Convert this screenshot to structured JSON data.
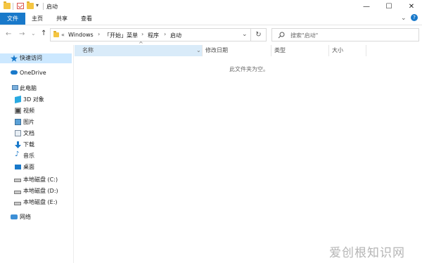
{
  "window": {
    "title": "启动",
    "minimize_glyph": "—",
    "maximize_glyph": "☐",
    "close_glyph": "✕",
    "help_glyph": "?",
    "expand_glyph": "⌄"
  },
  "quick_access_toolbar": {
    "dropdown_glyph": "▾"
  },
  "ribbon": {
    "tabs": [
      {
        "label": "文件"
      },
      {
        "label": "主页"
      },
      {
        "label": "共享"
      },
      {
        "label": "查看"
      }
    ]
  },
  "navigation": {
    "back_glyph": "←",
    "forward_glyph": "→",
    "recent_glyph": "⌄",
    "up_glyph": "↑",
    "refresh_glyph": "↻"
  },
  "address_bar": {
    "overflow": "«",
    "crumbs": [
      "Windows",
      "「开始」菜单",
      "程序",
      "启动"
    ],
    "separator": "›",
    "dropdown_glyph": "⌄"
  },
  "search": {
    "placeholder": "搜索\"启动\"",
    "icon": "search-icon"
  },
  "sidebar": {
    "quick_access": "快速访问",
    "onedrive": "OneDrive",
    "this_pc": "此电脑",
    "items": [
      {
        "label": "3D 对象",
        "icon": "cube-icon"
      },
      {
        "label": "视频",
        "icon": "video-icon"
      },
      {
        "label": "图片",
        "icon": "picture-icon"
      },
      {
        "label": "文档",
        "icon": "document-icon"
      },
      {
        "label": "下载",
        "icon": "download-icon"
      },
      {
        "label": "音乐",
        "icon": "music-icon"
      },
      {
        "label": "桌面",
        "icon": "desktop-icon"
      },
      {
        "label": "本地磁盘 (C:)",
        "icon": "drive-icon"
      },
      {
        "label": "本地磁盘 (D:)",
        "icon": "drive-icon"
      },
      {
        "label": "本地磁盘 (E:)",
        "icon": "drive-icon"
      }
    ],
    "network": "网络"
  },
  "columns": {
    "name": "名称",
    "modified": "修改日期",
    "type": "类型",
    "size": "大小",
    "sort_glyph": "^",
    "filter_glyph": "⌄"
  },
  "content": {
    "empty_message": "此文件夹为空。"
  },
  "watermark": "爱创根知识网",
  "colors": {
    "accent": "#1979ca",
    "selected_bg": "#cce8ff",
    "folder": "#f4c542"
  }
}
